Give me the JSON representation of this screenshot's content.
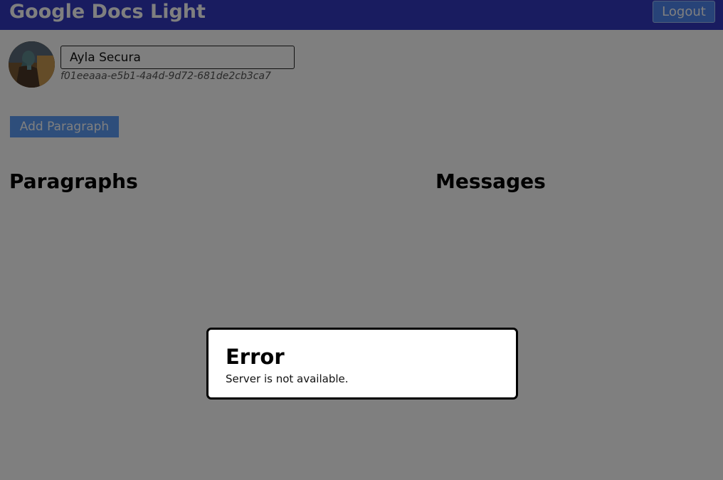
{
  "header": {
    "app_title": "Google Docs Light",
    "logout_label": "Logout"
  },
  "user": {
    "name": "Ayla Secura",
    "id": "f01eeaaa-e5b1-4a4d-9d72-681de2cb3ca7",
    "avatar_icon": "user-avatar-photo"
  },
  "actions": {
    "add_paragraph_label": "Add Paragraph"
  },
  "sections": {
    "paragraphs_title": "Paragraphs",
    "messages_title": "Messages"
  },
  "error_dialog": {
    "title": "Error",
    "message": "Server is not available."
  },
  "colors": {
    "header_bg": "#3238c0",
    "button_blue": "#5d9cf6",
    "overlay": "rgba(0,0,0,0.5)"
  }
}
